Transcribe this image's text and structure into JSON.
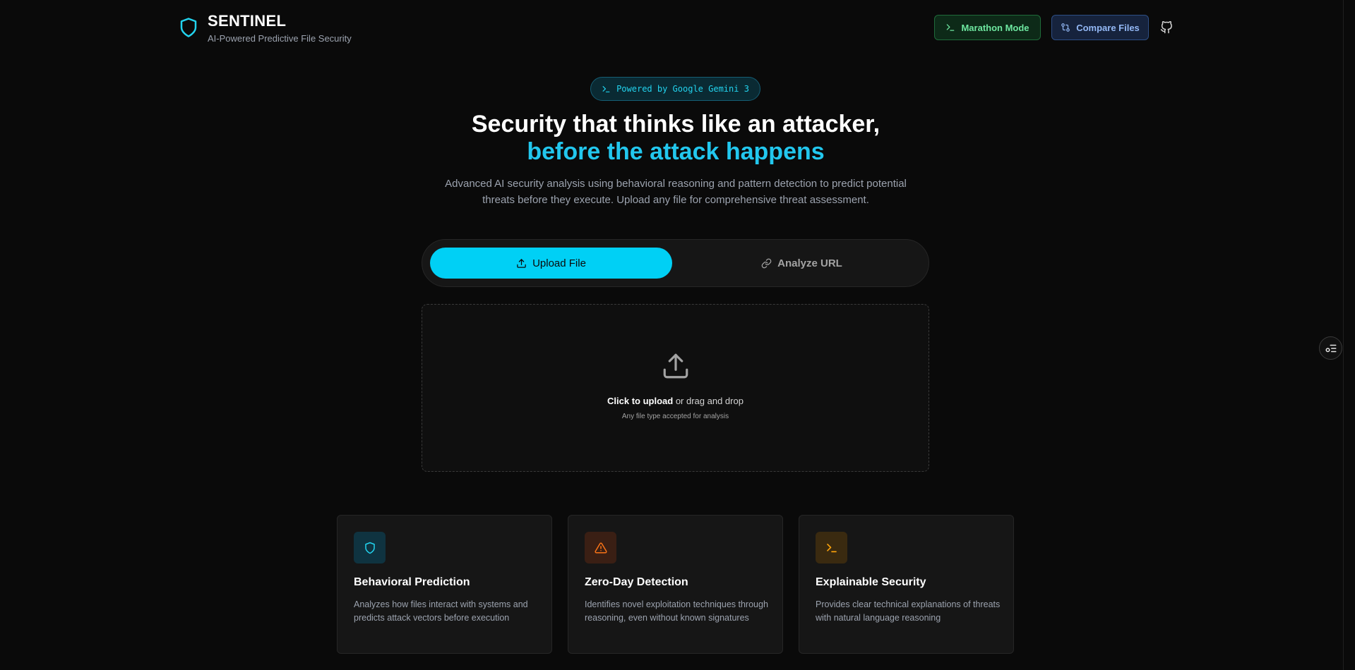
{
  "header": {
    "title": "SENTINEL",
    "subtitle": "AI-Powered Predictive File Security",
    "marathon_label": "Marathon Mode",
    "compare_label": "Compare Files"
  },
  "hero": {
    "badge": "Powered by Google Gemini 3",
    "title_line1": "Security that thinks like an attacker,",
    "title_line2": "before the attack happens",
    "description": "Advanced AI security analysis using behavioral reasoning and pattern detection to predict potential threats before they execute. Upload any file for comprehensive threat assessment."
  },
  "tabs": {
    "upload_label": "Upload File",
    "url_label": "Analyze URL"
  },
  "dropzone": {
    "click_text": "Click to upload",
    "rest_text": " or drag and drop",
    "hint": "Any file type accepted for analysis"
  },
  "features": [
    {
      "title": "Behavioral Prediction",
      "description": "Analyzes how files interact with systems and predicts attack vectors before execution",
      "icon": "shield-icon",
      "color": "#22d3ee"
    },
    {
      "title": "Zero-Day Detection",
      "description": "Identifies novel exploitation techniques through reasoning, even without known signatures",
      "icon": "warning-icon",
      "color": "#f97316"
    },
    {
      "title": "Explainable Security",
      "description": "Provides clear technical explanations of threats with natural language reasoning",
      "icon": "terminal-icon",
      "color": "#f59e0b"
    }
  ],
  "colors": {
    "accent": "#00d0f5",
    "background": "#0a0a0a"
  }
}
